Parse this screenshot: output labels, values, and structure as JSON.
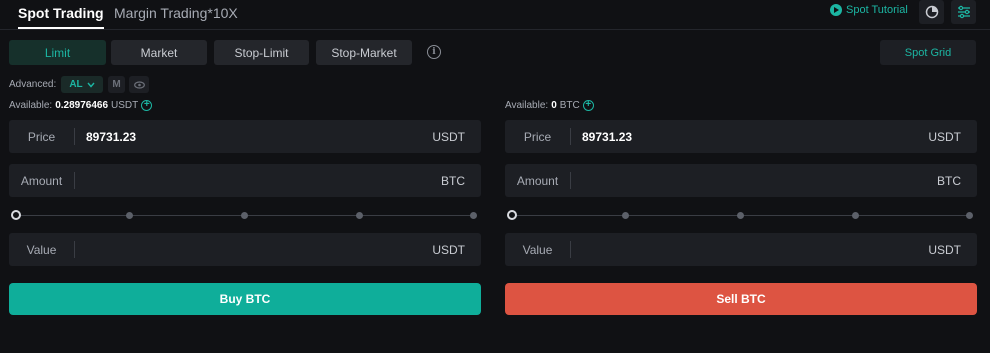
{
  "tabs": {
    "spot": "Spot Trading",
    "margin": "Margin Trading*10X"
  },
  "header": {
    "tutorial": "Spot Tutorial",
    "icons": [
      "pie-chart-icon",
      "settings-sliders-icon"
    ]
  },
  "order_types": [
    "Limit",
    "Market",
    "Stop-Limit",
    "Stop-Market"
  ],
  "active_order_type": "Limit",
  "spot_grid": "Spot Grid",
  "advanced": {
    "label": "Advanced:",
    "al": "AL",
    "m": "M"
  },
  "buy_panel": {
    "available_label": "Available:",
    "available_value": "0.28976466",
    "available_unit": "USDT",
    "price_label": "Price",
    "price_value": "89731.23",
    "price_unit": "USDT",
    "amount_label": "Amount",
    "amount_value": "",
    "amount_unit": "BTC",
    "value_label": "Value",
    "value_value": "",
    "value_unit": "USDT",
    "slider_percent": 0,
    "button": "Buy BTC"
  },
  "sell_panel": {
    "available_label": "Available:",
    "available_value": "0",
    "available_unit": "BTC",
    "price_label": "Price",
    "price_value": "89731.23",
    "price_unit": "USDT",
    "amount_label": "Amount",
    "amount_value": "",
    "amount_unit": "BTC",
    "value_label": "Value",
    "value_value": "",
    "value_unit": "USDT",
    "slider_percent": 0,
    "button": "Sell BTC"
  },
  "colors": {
    "accent": "#1cb6a3",
    "buy": "#0fae9a",
    "sell": "#dd5442",
    "background": "#101114",
    "panel": "#1d1f24"
  }
}
